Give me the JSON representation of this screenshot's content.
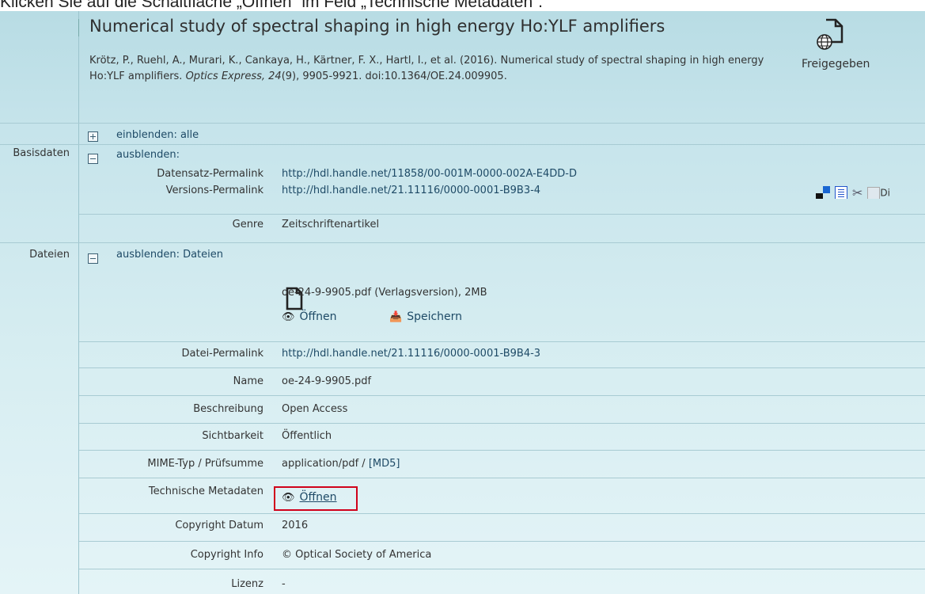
{
  "instruction": "Klicken Sie auf die Schaltfläche „Öffnen“ im Feld „Technische Metadaten“.",
  "record": {
    "title": "Numerical study of spectral shaping in high energy Ho:YLF amplifiers",
    "citation": {
      "authors_prefix": "Krötz, P., Ruehl, A., Murari, K., Cankaya, H., Kärtner, F. X., Hartl, I., et al. (2016). Numerical study of spectral shaping in high energy Ho:YLF amplifiers. ",
      "journal_volume": "Optics Express, 24",
      "suffix": "(9), 9905-9921. doi:10.1364/OE.24.009905."
    },
    "release_status": "Freigegeben",
    "release_icon": "globe-document-icon"
  },
  "expand_all": "einblenden: alle",
  "sections": {
    "basic": {
      "label": "Basisdaten",
      "toggle": "ausblenden:",
      "dataset_permalink_label": "Datensatz-Permalink",
      "dataset_permalink": "http://hdl.handle.net/11858/00-001M-0000-002A-E4DD-D",
      "version_permalink_label": "Versions-Permalink",
      "version_permalink": "http://hdl.handle.net/21.11116/0000-0001-B9B3-4",
      "broken_image_text": "Di",
      "genre_label": "Genre",
      "genre": "Zeitschriftenartikel"
    },
    "files": {
      "label": "Dateien",
      "toggle": "ausblenden: Dateien",
      "file_title": "oe-24-9-9905.pdf (Verlagsversion), 2MB",
      "open": "Öffnen",
      "save": "Speichern",
      "rows": [
        {
          "label": "Datei-Permalink",
          "value": "http://hdl.handle.net/21.11116/0000-0001-B9B4-3"
        },
        {
          "label": "Name",
          "value": "oe-24-9-9905.pdf"
        },
        {
          "label": "Beschreibung",
          "value": "Open Access"
        },
        {
          "label": "Sichtbarkeit",
          "value": "Öffentlich"
        },
        {
          "label": "MIME-Typ / Prüfsumme",
          "value": "application/pdf / ",
          "link": "[MD5]"
        },
        {
          "label": "Technische Metadaten",
          "value": "Öffnen"
        },
        {
          "label": "Copyright Datum",
          "value": "2016"
        },
        {
          "label": "Copyright Info",
          "value": "© Optical Society of America"
        },
        {
          "label": "Lizenz",
          "value": "-"
        }
      ]
    }
  },
  "colors": {
    "panel_top": "#b8dce4",
    "panel_bottom": "#e4f4f7",
    "link": "#1e4a66",
    "highlight": "#d0021b"
  }
}
